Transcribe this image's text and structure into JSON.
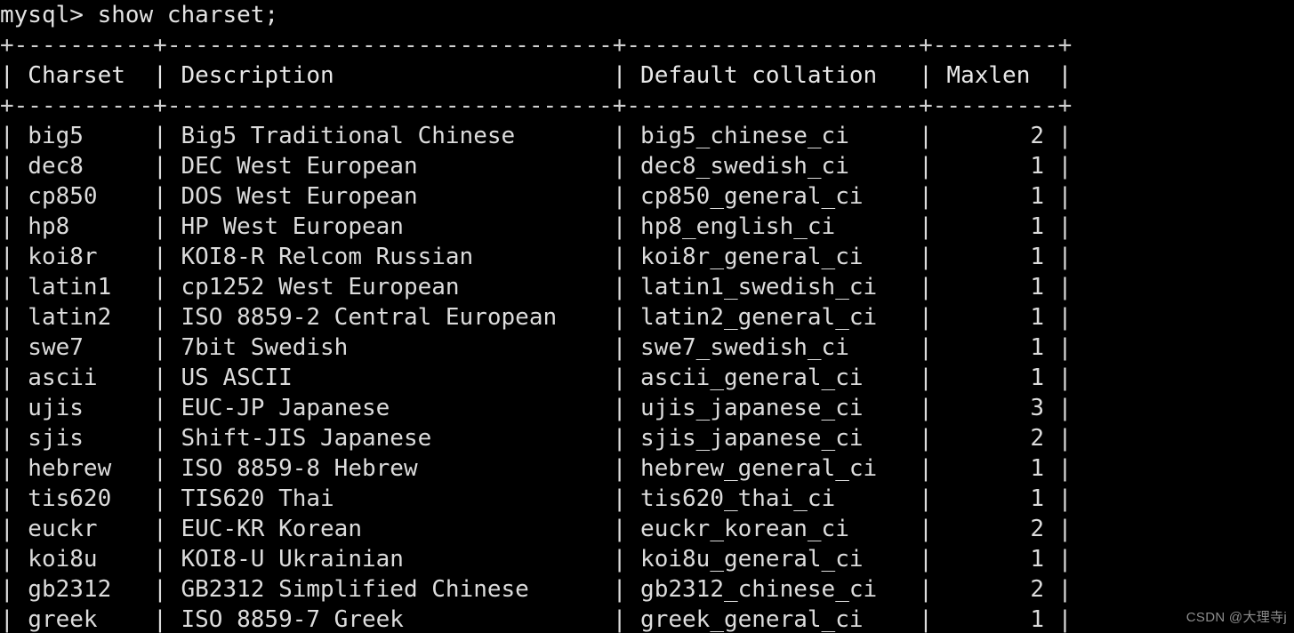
{
  "terminal": {
    "prompt": "mysql> ",
    "command": "show charset;",
    "prompt_line": "mysql> show charset;",
    "background_color": "#000000",
    "text_color": "#d8d8d8"
  },
  "table": {
    "columns": [
      {
        "header": "Charset",
        "width": 8,
        "align": "left"
      },
      {
        "header": "Description",
        "width": 30,
        "align": "left"
      },
      {
        "header": "Default collation",
        "width": 19,
        "align": "left"
      },
      {
        "header": "Maxlen",
        "width": 7,
        "align": "right"
      }
    ],
    "separator_line": "+----------+------------------------------+---------------------+--------+",
    "header_line": "| Charset  | Description                  | Default collation   | Maxlen |",
    "rows": [
      {
        "charset": "big5",
        "description": "Big5 Traditional Chinese",
        "collation": "big5_chinese_ci",
        "maxlen": "2"
      },
      {
        "charset": "dec8",
        "description": "DEC West European",
        "collation": "dec8_swedish_ci",
        "maxlen": "1"
      },
      {
        "charset": "cp850",
        "description": "DOS West European",
        "collation": "cp850_general_ci",
        "maxlen": "1"
      },
      {
        "charset": "hp8",
        "description": "HP West European",
        "collation": "hp8_english_ci",
        "maxlen": "1"
      },
      {
        "charset": "koi8r",
        "description": "KOI8-R Relcom Russian",
        "collation": "koi8r_general_ci",
        "maxlen": "1"
      },
      {
        "charset": "latin1",
        "description": "cp1252 West European",
        "collation": "latin1_swedish_ci",
        "maxlen": "1"
      },
      {
        "charset": "latin2",
        "description": "ISO 8859-2 Central European",
        "collation": "latin2_general_ci",
        "maxlen": "1"
      },
      {
        "charset": "swe7",
        "description": "7bit Swedish",
        "collation": "swe7_swedish_ci",
        "maxlen": "1"
      },
      {
        "charset": "ascii",
        "description": "US ASCII",
        "collation": "ascii_general_ci",
        "maxlen": "1"
      },
      {
        "charset": "ujis",
        "description": "EUC-JP Japanese",
        "collation": "ujis_japanese_ci",
        "maxlen": "3"
      },
      {
        "charset": "sjis",
        "description": "Shift-JIS Japanese",
        "collation": "sjis_japanese_ci",
        "maxlen": "2"
      },
      {
        "charset": "hebrew",
        "description": "ISO 8859-8 Hebrew",
        "collation": "hebrew_general_ci",
        "maxlen": "1"
      },
      {
        "charset": "tis620",
        "description": "TIS620 Thai",
        "collation": "tis620_thai_ci",
        "maxlen": "1"
      },
      {
        "charset": "euckr",
        "description": "EUC-KR Korean",
        "collation": "euckr_korean_ci",
        "maxlen": "2"
      },
      {
        "charset": "koi8u",
        "description": "KOI8-U Ukrainian",
        "collation": "koi8u_general_ci",
        "maxlen": "1"
      },
      {
        "charset": "gb2312",
        "description": "GB2312 Simplified Chinese",
        "collation": "gb2312_chinese_ci",
        "maxlen": "2"
      },
      {
        "charset": "greek",
        "description": "ISO 8859-7 Greek",
        "collation": "greek_general_ci",
        "maxlen": "1"
      }
    ]
  },
  "watermark": {
    "text": "CSDN @大理寺j"
  }
}
